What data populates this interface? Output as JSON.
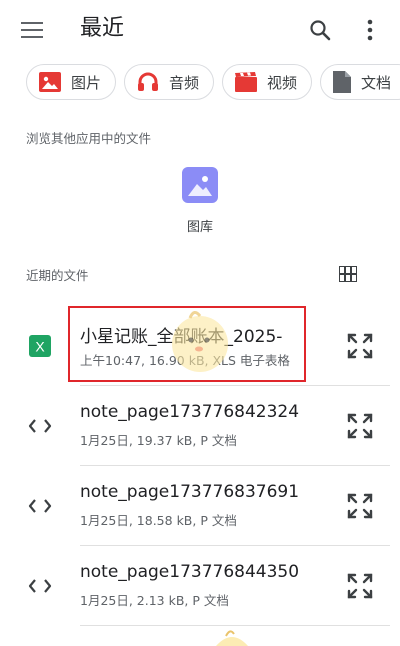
{
  "header": {
    "title": "最近",
    "menu_icon": "menu-icon",
    "search_icon": "search-icon",
    "more_icon": "more-vert-icon"
  },
  "chips": [
    {
      "label": "图片",
      "icon": "image-icon",
      "color": "#e53935"
    },
    {
      "label": "音频",
      "icon": "headphones-icon",
      "color": "#e53935"
    },
    {
      "label": "视频",
      "icon": "movie-icon",
      "color": "#e53935"
    },
    {
      "label": "文档",
      "icon": "document-icon",
      "color": "#5f6368"
    }
  ],
  "browse_section": {
    "label": "浏览其他应用中的文件",
    "apps": [
      {
        "label": "图库",
        "icon": "gallery-icon",
        "color": "#8b8cf6"
      }
    ]
  },
  "recent_section": {
    "label": "近期的文件",
    "view_toggle_icon": "grid-view-icon"
  },
  "files": [
    {
      "name": "小星记账_全部账本_2025-",
      "meta": "上午10:47, 16.90 kB, XLS 电子表格",
      "icon": "excel-icon",
      "highlighted": true
    },
    {
      "name": "note_page173776842324",
      "meta": "1月25日, 19.37 kB, P 文档",
      "icon": "code-icon"
    },
    {
      "name": "note_page173776837691",
      "meta": "1月25日, 18.58 kB, P 文档",
      "icon": "code-icon"
    },
    {
      "name": "note_page173776844350",
      "meta": "1月25日, 2.13 kB, P 文档",
      "icon": "code-icon"
    }
  ],
  "colors": {
    "accent_red": "#e53935",
    "excel_green": "#1fa463",
    "highlight_box": "#e0262b"
  }
}
